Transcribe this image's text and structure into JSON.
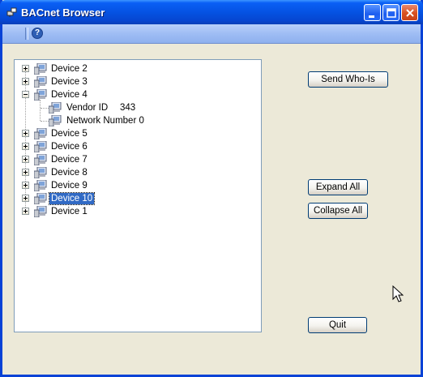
{
  "window": {
    "title": "BACnet Browser"
  },
  "titlebar": {
    "buttons": [
      "minimize",
      "maximize",
      "close"
    ]
  },
  "toolbar": {
    "help_icon": "help-icon"
  },
  "tree": {
    "nodes": [
      {
        "label": "Device 2",
        "expanded": false
      },
      {
        "label": "Device 3",
        "expanded": false
      },
      {
        "label": "Device 4",
        "expanded": true,
        "children": [
          {
            "label": "Vendor ID",
            "value": "343"
          },
          {
            "label": "Network Number 0"
          }
        ]
      },
      {
        "label": "Device 5",
        "expanded": false
      },
      {
        "label": "Device 6",
        "expanded": false
      },
      {
        "label": "Device 7",
        "expanded": false
      },
      {
        "label": "Device 8",
        "expanded": false
      },
      {
        "label": "Device 9",
        "expanded": false
      },
      {
        "label": "Device 10",
        "expanded": false,
        "selected": true
      },
      {
        "label": "Device 1",
        "expanded": false
      }
    ]
  },
  "buttons": {
    "send_whois": "Send Who-Is",
    "expand_all": "Expand All",
    "collapse_all": "Collapse All",
    "quit": "Quit"
  },
  "colors": {
    "title_bar": "#0551e0",
    "selection": "#316ac5",
    "background": "#ece9d8"
  }
}
